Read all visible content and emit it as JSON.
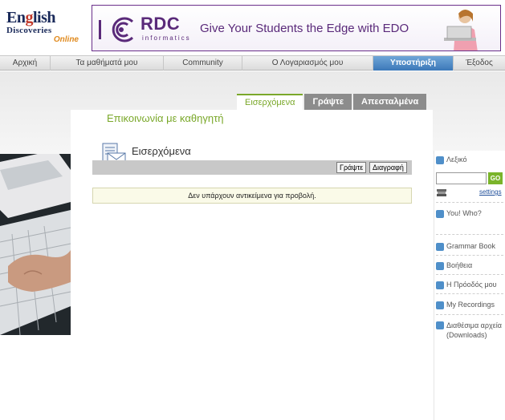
{
  "logo": {
    "line1_pre": "En",
    "line1_g": "g",
    "line1_post": "lish",
    "line2": "Discoveries",
    "line3": "Online"
  },
  "banner": {
    "brand": "RDC",
    "brand_sub": "informatics",
    "tagline": "Give Your Students the Edge with EDO"
  },
  "nav": {
    "items": [
      {
        "label": "Αρχική",
        "active": false
      },
      {
        "label": "Τα μαθήματά μου",
        "active": false
      },
      {
        "label": "Community",
        "active": false
      },
      {
        "label": "Ο Λογαριασμός μου",
        "active": false
      },
      {
        "label": "Υποστήριξη",
        "active": true
      },
      {
        "label": "Έξοδος",
        "active": false
      }
    ]
  },
  "tabs": {
    "inbox": "Εισερχόμενα",
    "write": "Γράψτε",
    "sent": "Απεσταλμένα"
  },
  "page": {
    "title": "Επικοινωνία με καθηγητή",
    "section_title": "Εισερχόμενα"
  },
  "toolbar": {
    "write_label": "Γράψτε",
    "delete_label": "Διαγραφή"
  },
  "empty_message": "Δεν υπάρχουν αντικείμενα για προβολή.",
  "right_panel": {
    "dictionary_label": "Λεξικό",
    "go_label": "GO",
    "settings_label": "settings",
    "you_who": "You! Who?",
    "grammar_book": "Grammar Book",
    "help": "Βοήθεια",
    "my_progress": "Η Πρόοδός μου",
    "my_recordings": "My Recordings",
    "available_files": "Διαθέσιμα αρχεία (Downloads)"
  },
  "colors": {
    "accent_green": "#7aa82a",
    "nav_active": "#3c78b8",
    "brand_purple": "#5a2a7a"
  }
}
